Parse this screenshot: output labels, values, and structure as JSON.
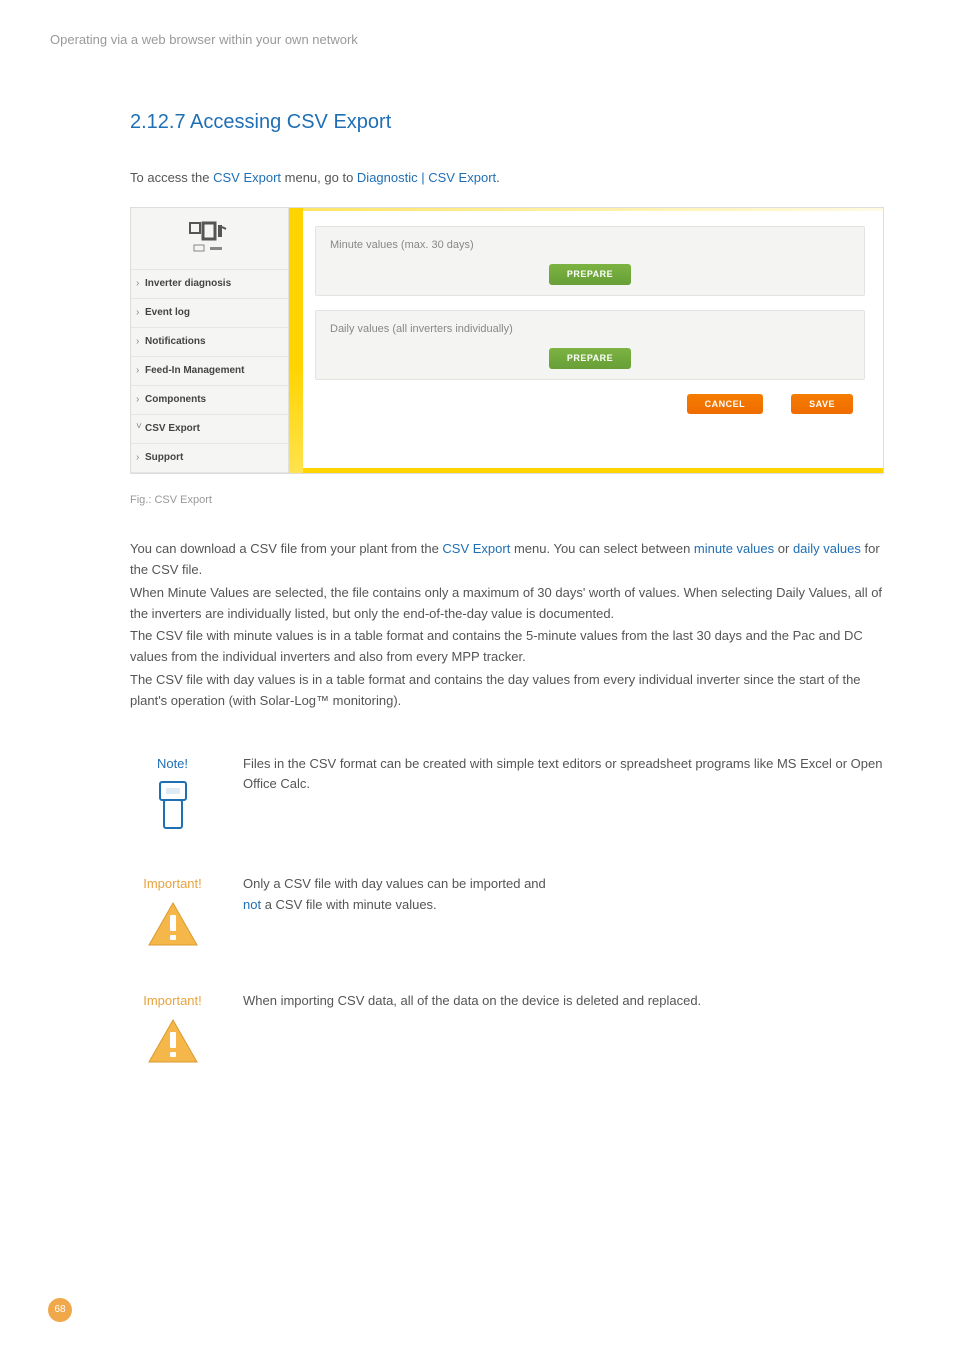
{
  "header": "Operating via a web browser within your own network",
  "section_title": "2.12.7 Accessing CSV Export",
  "intro": {
    "pre": "To access the ",
    "hl1": "CSV Export",
    "mid": " menu, go to ",
    "hl2": "Diagnostic | CSV Export",
    "post": "."
  },
  "screenshot": {
    "sidebar": {
      "items": [
        {
          "label": "Inverter diagnosis"
        },
        {
          "label": "Event log"
        },
        {
          "label": "Notifications"
        },
        {
          "label": "Feed-In Management"
        },
        {
          "label": "Components"
        },
        {
          "label": "CSV Export",
          "active": true
        },
        {
          "label": "Support"
        }
      ]
    },
    "panel1": {
      "title": "Minute values (max. 30 days)",
      "button": "PREPARE"
    },
    "panel2": {
      "title": "Daily values (all inverters individually)",
      "button": "PREPARE"
    },
    "actions": {
      "cancel": "CANCEL",
      "save": "SAVE"
    }
  },
  "fig_caption": "Fig.: CSV Export",
  "body": {
    "p1_pre": "You can download a CSV file from your plant from the ",
    "p1_hl1": "CSV Export",
    "p1_mid": " menu. You can select between ",
    "p1_hl2": "minute values",
    "p1_or": " or ",
    "p1_hl3": "daily values",
    "p1_post": " for the CSV file.",
    "p2": "When Minute Values are selected, the file contains only a maximum of 30 days' worth of values. When selecting Daily Values, all of the inverters are individually listed, but only the end-of-the-day value is documented.",
    "p3": "The CSV file with minute values is in a table format and contains the 5-minute values from the last 30 days and the Pac and DC values from the individual inverters and also from every MPP tracker.",
    "p4": "The CSV file with day values is in a table format and contains the day values from every individual inverter since the start of the plant's operation (with Solar-Log™ monitoring)."
  },
  "callouts": {
    "note": {
      "label": "Note!",
      "text": "Files in the CSV format can be created with simple text editors or spreadsheet programs like MS Excel or Open Office Calc."
    },
    "imp1": {
      "label": "Important!",
      "line1": "Only a CSV file with day values can be imported and",
      "hl": "not",
      "line2": " a CSV file with minute values."
    },
    "imp2": {
      "label": "Important!",
      "text": "When importing CSV data, all of the data on the device is deleted and replaced."
    }
  },
  "page_number": "68"
}
